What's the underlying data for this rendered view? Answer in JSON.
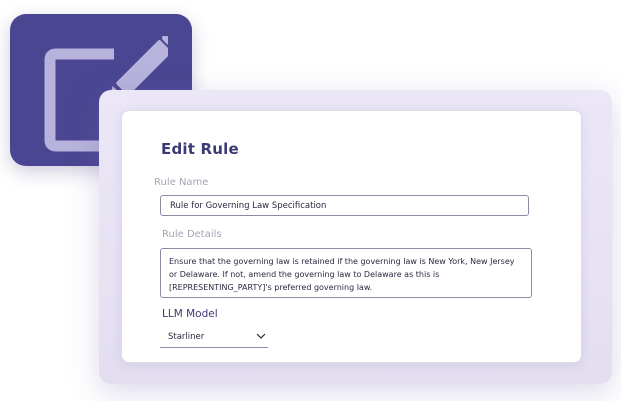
{
  "dialog": {
    "title": "Edit Rule",
    "rule_name_label": "Rule Name",
    "rule_name_value": "Rule for Governing Law Specification",
    "rule_details_label": "Rule Details",
    "rule_details_value": "Ensure that the governing law is retained if the governing law is New York, New Jersey or Delaware. If not, amend the governing law to Delaware as this is [REPRESENTING_PARTY]'s preferred governing law.",
    "llm_model_label": "LLM Model",
    "llm_model_value": "Starliner"
  },
  "icons": {
    "tile_icon": "edit-icon",
    "select_icon": "chevron-down-icon"
  },
  "colors": {
    "brand": "#4b4691",
    "title": "#3d3a73"
  }
}
